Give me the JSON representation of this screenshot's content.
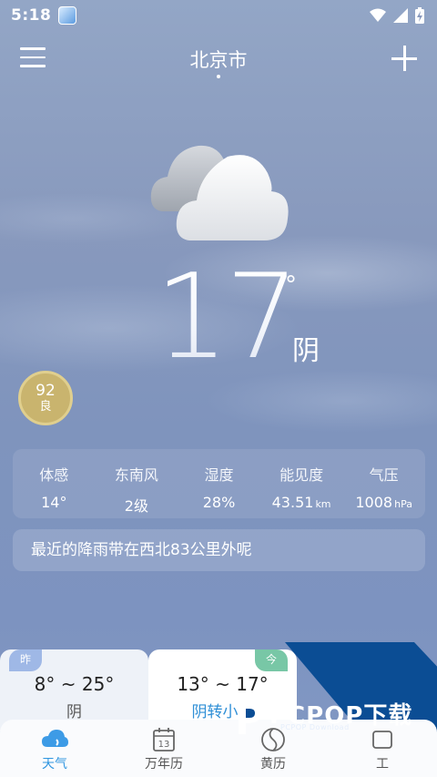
{
  "status_bar": {
    "time": "5:18",
    "icons": [
      "app-notification-icon",
      "wifi-icon",
      "signal-icon",
      "battery-charging-icon"
    ]
  },
  "header": {
    "city": "北京市",
    "menu_icon": "hamburger-menu-icon",
    "add_icon": "plus-icon"
  },
  "current": {
    "icon": "cloudy-icon",
    "temperature": "17",
    "degree_symbol": "°",
    "condition": "阴",
    "aqi": {
      "value": "92",
      "level": "良",
      "color": "#c9b46e"
    }
  },
  "details": [
    {
      "label": "体感",
      "value": "14°",
      "unit": ""
    },
    {
      "label": "东南风",
      "value": "2级",
      "unit": ""
    },
    {
      "label": "湿度",
      "value": "28%",
      "unit": ""
    },
    {
      "label": "能见度",
      "value": "43.51",
      "unit": "km"
    },
    {
      "label": "气压",
      "value": "1008",
      "unit": "hPa"
    }
  ],
  "rain_notice": "最近的降雨带在西北83公里外呢",
  "forecast": [
    {
      "badge": "昨",
      "range": "8° ~ 25°",
      "condition": "阴"
    },
    {
      "badge": "今",
      "range": "13° ~ 17°",
      "condition": "阴转小雨"
    }
  ],
  "watermark": {
    "text": "PCPOP下载",
    "sub": "PCPOP Download",
    "color": "#0b4d94"
  },
  "bottom_nav": [
    {
      "label": "天气",
      "icon": "weather-cloud-icon",
      "active": true
    },
    {
      "label": "万年历",
      "icon": "calendar-icon",
      "active": false
    },
    {
      "label": "黄历",
      "icon": "almanac-icon",
      "active": false
    },
    {
      "label": "工",
      "icon": "tools-icon",
      "active": false
    }
  ],
  "colors": {
    "accent": "#2f95e0",
    "background": "#8899bd"
  }
}
